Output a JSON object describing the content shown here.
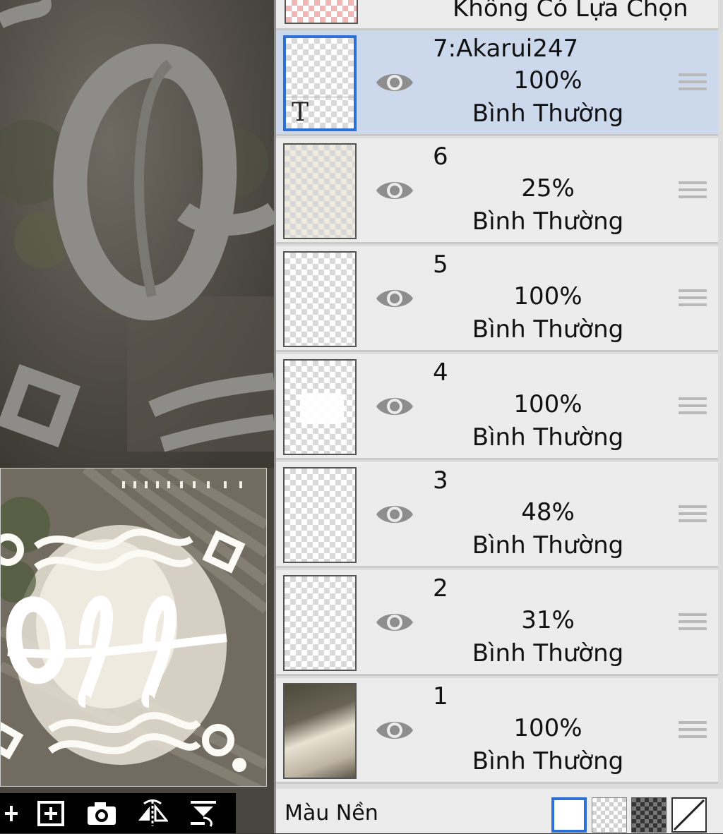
{
  "top_partial": {
    "label": "Không Có Lựa Chọn"
  },
  "layers": [
    {
      "name": "7:Akarui247",
      "opacity": "100%",
      "blend": "Bình Thường",
      "selected": true,
      "thumb_glyph": "T"
    },
    {
      "name": "6",
      "opacity": "25%",
      "blend": "Bình Thường",
      "selected": false
    },
    {
      "name": "5",
      "opacity": "100%",
      "blend": "Bình Thường",
      "selected": false
    },
    {
      "name": "4",
      "opacity": "100%",
      "blend": "Bình Thường",
      "selected": false
    },
    {
      "name": "3",
      "opacity": "48%",
      "blend": "Bình Thường",
      "selected": false
    },
    {
      "name": "2",
      "opacity": "31%",
      "blend": "Bình Thường",
      "selected": false
    },
    {
      "name": "1",
      "opacity": "100%",
      "blend": "Bình Thường",
      "selected": false
    }
  ],
  "background_color": {
    "label": "Màu Nền",
    "options": [
      "white",
      "checker-light",
      "checker-dark",
      "none"
    ],
    "selected": "white"
  },
  "toolbar": {
    "icons": [
      "plus-icon",
      "add-layer-icon",
      "camera-icon",
      "flip-horizontal-icon",
      "merge-down-icon"
    ]
  },
  "colors": {
    "selected_row": "#ccd9ec",
    "row": "#ececec",
    "accent": "#2e6fd6"
  }
}
